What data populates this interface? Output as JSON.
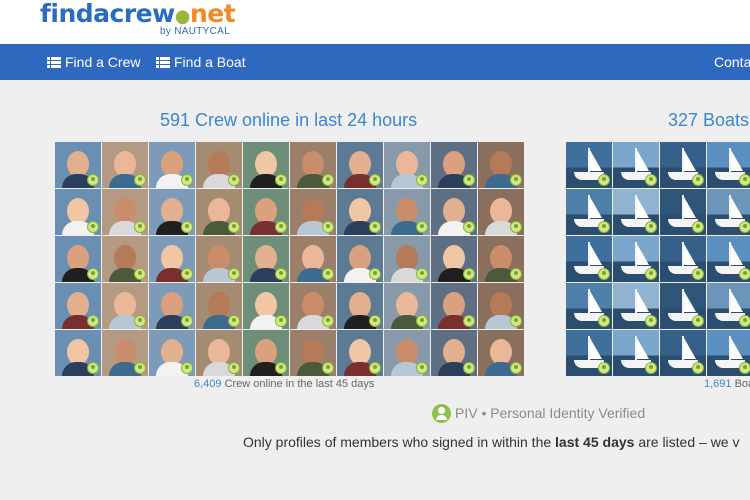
{
  "logo": {
    "find": "find",
    "crew": "acrew",
    "dot": "●",
    "net": "net",
    "byline": "by NAUTYCAL"
  },
  "nav": {
    "find_crew": "Find a Crew",
    "find_boat": "Find a Boat",
    "contact": "Conta"
  },
  "crew_section": {
    "title": "591 Crew online in last 24 hours",
    "stat_number": "6,409",
    "stat_text": " Crew online in the last 45 days"
  },
  "boat_section": {
    "title": "327 Boats",
    "stat_number": "1,691",
    "stat_text": " Boa"
  },
  "piv": {
    "text": "PIV • Personal Identity Verified"
  },
  "notice": {
    "before": "Only profiles of members who signed in within the ",
    "bold": "last 45 days",
    "after": " are listed – we v"
  },
  "colors": {
    "nav_bg": "#2f69bf",
    "accent_blue": "#3a86d6",
    "verified_green": "#8cc04a"
  }
}
